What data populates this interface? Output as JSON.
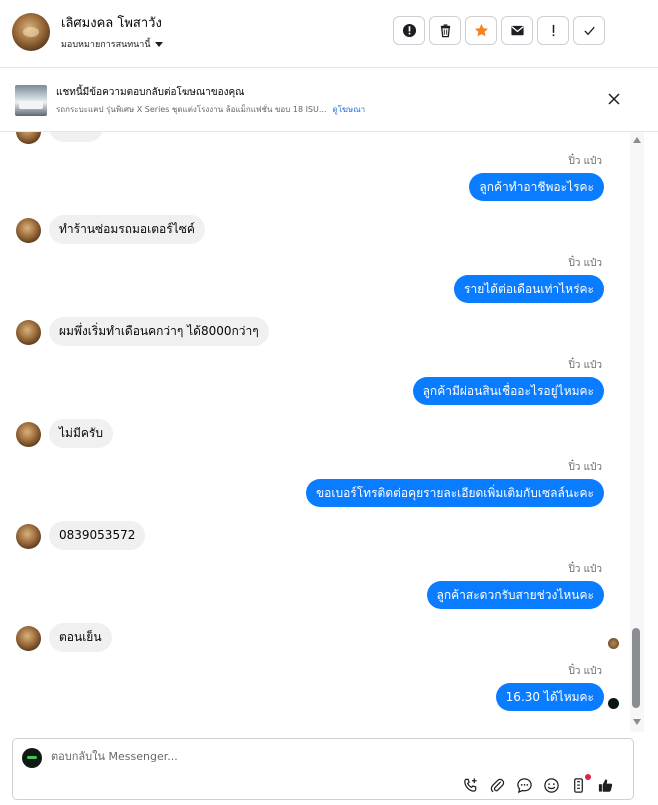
{
  "header": {
    "contact_name": "เลิศมงคล โพสาวัง",
    "assign_label": "มอบหมายการสนทนานี้",
    "actions": [
      {
        "name": "spam-button",
        "icon": "alert-circle-icon"
      },
      {
        "name": "delete-button",
        "icon": "trash-icon"
      },
      {
        "name": "star-button",
        "icon": "star-icon"
      },
      {
        "name": "mark-unread-button",
        "icon": "envelope-icon"
      },
      {
        "name": "follow-up-button",
        "icon": "exclamation-icon"
      },
      {
        "name": "mark-done-button",
        "icon": "check-icon"
      }
    ],
    "colors": {
      "star": "#f5821f"
    }
  },
  "ad_banner": {
    "title": "แชทนี้มีข้อความตอบกลับต่อโฆษณาของคุณ",
    "subtitle": "รถกระบะแคป รุ่นพิเศษ X Series ชุดแต่งโรงงาน ล้อแม็กแฟชั่น ขอบ 18 ISU...",
    "link": "ดูโฆษณา"
  },
  "messages": [
    {
      "dir": "out",
      "sender": "ปิ๋ว แป๋ว",
      "text": "ลูกค้าทำอาชีพอะไรคะ"
    },
    {
      "dir": "in",
      "text": "ทำร้านซ่อมรถมอเตอร์ไซค์"
    },
    {
      "dir": "out",
      "sender": "ปิ๋ว แป๋ว",
      "text": "รายได้ต่อเดือนเท่าไหร่คะ"
    },
    {
      "dir": "in",
      "text": "ผมพึ่งเริ่มทำเดือนคกว่าๆ ได้8000กว่าๆ"
    },
    {
      "dir": "out",
      "sender": "ปิ๋ว แป๋ว",
      "text": "ลูกค้ามีผ่อนสินเชื่ออะไรอยู่ไหมคะ"
    },
    {
      "dir": "in",
      "text": "ไม่มีครับ"
    },
    {
      "dir": "out",
      "sender": "ปิ๋ว แป๋ว",
      "text": "ขอเบอร์โทรติดต่อคุยรายละเอียดเพิ่มเติมกับเซลล์นะคะ"
    },
    {
      "dir": "in",
      "text": "0839053572"
    },
    {
      "dir": "out",
      "sender": "ปิ๋ว แป๋ว",
      "text": "ลูกค้าสะดวกรับสายช่วงไหนคะ"
    },
    {
      "dir": "in",
      "text": "ตอนเย็น"
    },
    {
      "dir": "out",
      "sender": "ปิ๋ว แป๋ว",
      "text": "16.30  ได้ไหมคะ"
    }
  ],
  "composer": {
    "placeholder": "ตอบกลับใน Messenger...",
    "tools": [
      "call-add-icon",
      "attachment-icon",
      "saved-replies-icon",
      "emoji-icon",
      "app-icon",
      "like-icon"
    ]
  },
  "colors": {
    "outgoing": "#0a7cff",
    "incoming": "#f0f0f0",
    "link": "#216fdb"
  }
}
